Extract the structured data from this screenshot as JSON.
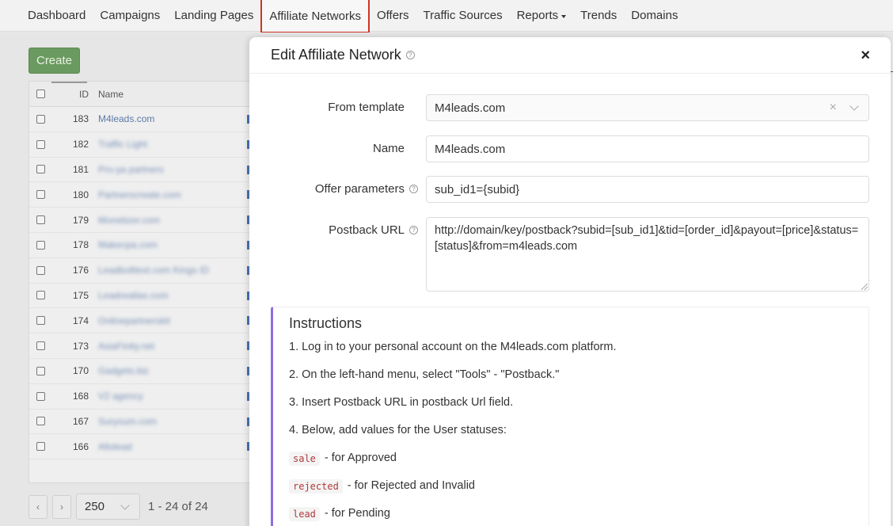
{
  "nav": {
    "items": [
      {
        "label": "Dashboard"
      },
      {
        "label": "Campaigns"
      },
      {
        "label": "Landing Pages"
      },
      {
        "label": "Affiliate Networks",
        "active": true
      },
      {
        "label": "Offers"
      },
      {
        "label": "Traffic Sources"
      },
      {
        "label": "Reports",
        "dropdown": true
      },
      {
        "label": "Trends"
      },
      {
        "label": "Domains"
      }
    ]
  },
  "list": {
    "create_label": "Create",
    "headers": {
      "id": "ID",
      "name": "Name"
    },
    "rows": [
      {
        "id": "183",
        "name": "M4leads.com",
        "blurred": false
      },
      {
        "id": "182",
        "name": "Traffic Light",
        "blurred": true
      },
      {
        "id": "181",
        "name": "Pro-ya partners",
        "blurred": true
      },
      {
        "id": "180",
        "name": "Partnerscreate.com",
        "blurred": true
      },
      {
        "id": "179",
        "name": "Monetizer.com",
        "blurred": true
      },
      {
        "id": "178",
        "name": "Makecpa.com",
        "blurred": true
      },
      {
        "id": "176",
        "name": "Leadbolttext.com Kings ID",
        "blurred": true
      },
      {
        "id": "175",
        "name": "Leadreatlas.com",
        "blurred": true
      },
      {
        "id": "174",
        "name": "Onlinepartnerskit",
        "blurred": true
      },
      {
        "id": "173",
        "name": "AsiaFinity.net",
        "blurred": true
      },
      {
        "id": "170",
        "name": "Gadgets.biz",
        "blurred": true
      },
      {
        "id": "168",
        "name": "V2 agency",
        "blurred": true
      },
      {
        "id": "167",
        "name": "Suryoum.com",
        "blurred": true
      },
      {
        "id": "166",
        "name": "Allolead",
        "blurred": true
      }
    ],
    "pager": {
      "prev": "‹",
      "next": "›",
      "page_size": "250",
      "info": "1 - 24 of 24"
    }
  },
  "modal": {
    "title": "Edit Affiliate Network",
    "close_label": "×",
    "fields": {
      "template": {
        "label": "From template",
        "value": "M4leads.com"
      },
      "name": {
        "label": "Name",
        "value": "M4leads.com"
      },
      "offer_params": {
        "label": "Offer parameters",
        "value": "sub_id1={subid}"
      },
      "postback": {
        "label": "Postback URL",
        "value": "http://domain/key/postback?subid=[sub_id1]&tid=[order_id]&payout=[price]&status=[status]&from=m4leads.com"
      }
    },
    "instructions": {
      "title": "Instructions",
      "steps": [
        "1. Log in to your personal account on the M4leads.com platform.",
        "2. On the left-hand menu, select \"Tools\" - \"Postback.\"",
        "3. Insert Postback URL in postback Url field.",
        "4. Below, add values for the User statuses:"
      ],
      "statuses": [
        {
          "code": "sale",
          "text": "- for Approved"
        },
        {
          "code": "rejected",
          "text": "- for Rejected and Invalid"
        },
        {
          "code": "lead",
          "text": "- for Pending"
        }
      ]
    }
  },
  "colors": {
    "accent_purple": "#8f6ee0",
    "active_nav_border": "#d0341f",
    "create_green": "#6a9a5f"
  }
}
